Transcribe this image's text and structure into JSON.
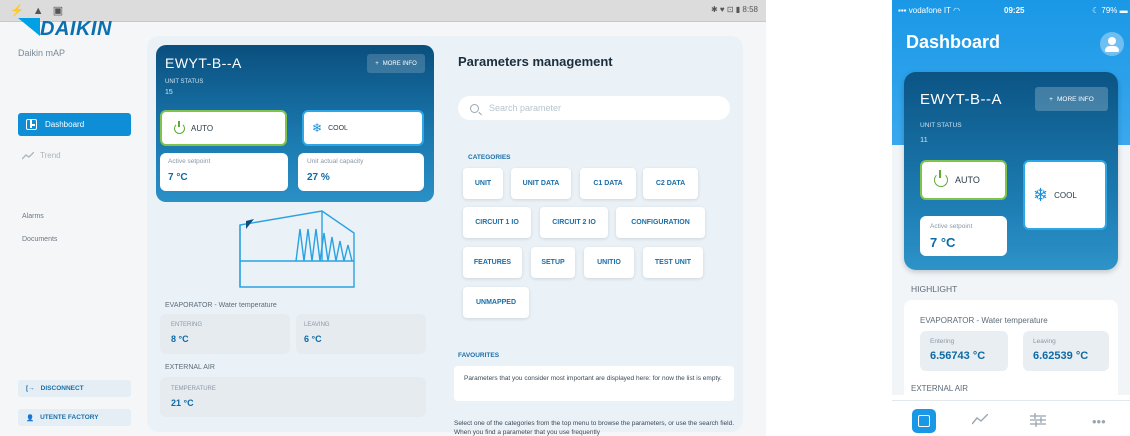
{
  "tablet": {
    "status_bar": {
      "left_icons": "⚡ ▲ ▣",
      "right_text": "✱ ♥ ⊡ ▮ 8:58"
    },
    "sidebar": {
      "brand": "DAIKIN",
      "app_name": "Daikin mAP",
      "items": [
        {
          "label": "Dashboard",
          "active": true
        },
        {
          "label": "Trend"
        },
        {
          "label": "Alarms"
        },
        {
          "label": "Documents"
        }
      ],
      "disconnect_label": "DISCONNECT",
      "user_label": "UTENTE FACTORY"
    },
    "unit": {
      "name": "EWYT-B--A",
      "status_label": "UNIT STATUS",
      "status_value": "15",
      "more_info_label": "MORE INFO",
      "mode_auto": "AUTO",
      "mode_cool": "COOL",
      "setpoint_label": "Active setpoint",
      "setpoint_value": "7 °C",
      "capacity_label": "Unit actual capacity",
      "capacity_value": "27 %"
    },
    "evaporator": {
      "title": "EVAPORATOR - Water temperature",
      "entering_label": "ENTERING",
      "entering_value": "8 °C",
      "leaving_label": "LEAVING",
      "leaving_value": "6 °C"
    },
    "external_air": {
      "title": "EXTERNAL AIR",
      "temperature_label": "TEMPERATURE",
      "temperature_value": "21 °C"
    },
    "parameters": {
      "title": "Parameters management",
      "search_placeholder": "Search parameter",
      "categories_label": "CATEGORIES",
      "categories": [
        "UNIT",
        "UNIT DATA",
        "C1 DATA",
        "C2 DATA",
        "CIRCUIT 1 IO",
        "CIRCUIT 2 IO",
        "CONFIGURATION",
        "FEATURES",
        "SETUP",
        "UNITIO",
        "TEST UNIT",
        "UNMAPPED"
      ],
      "favourites_label": "FAVOURITES",
      "favourites_text": "Parameters that you consider most important are displayed here: for now the list is empty.",
      "select_text": "Select one of the categories from the top menu to browse the parameters, or use the search field. When you find a parameter that you use frequently"
    }
  },
  "phone": {
    "status_bar": {
      "carrier": "vodafone IT",
      "time": "09:25",
      "battery": "79%"
    },
    "title": "Dashboard",
    "unit": {
      "name": "EWYT-B--A",
      "more_info_label": "MORE INFO",
      "status_label": "UNIT STATUS",
      "status_value": "11",
      "mode_auto": "AUTO",
      "mode_cool": "COOL",
      "setpoint_label": "Active setpoint",
      "setpoint_value": "7 °C"
    },
    "highlight_label": "HIGHLIGHT",
    "evaporator_title": "EVAPORATOR - Water temperature",
    "entering_label": "Entering",
    "entering_value": "6.56743 °C",
    "leaving_label": "Leaving",
    "leaving_value": "6.62539 °C",
    "external_air_title": "EXTERNAL AIR",
    "tabs": [
      "dashboard-icon",
      "trend-icon",
      "sliders-icon",
      "more-icon"
    ]
  },
  "colors": {
    "brand_blue": "#0d8ed6",
    "auto_green": "#7fc34c",
    "cool_blue": "#2ea7e6",
    "value_blue": "#0d6aa6"
  }
}
